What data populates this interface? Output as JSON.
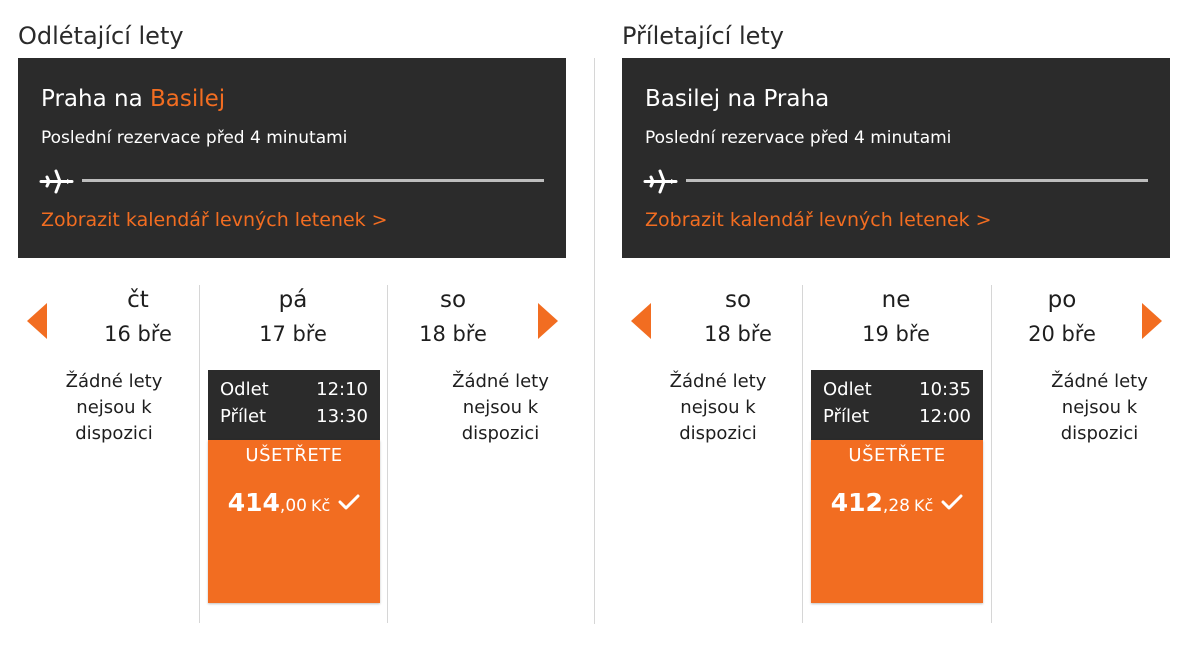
{
  "outbound": {
    "section_title": "Odlétající lety",
    "route_from": "Praha na",
    "route_to": "Basilej",
    "last_booking": "Poslední rezervace před 4 minutami",
    "calendar_link": "Zobrazit kalendář levných letenek >",
    "days": [
      {
        "day": "čt",
        "date": "16 bře",
        "no_flights": [
          "Žádné lety",
          "nejsou k",
          "dispozici"
        ]
      },
      {
        "day": "pá",
        "date": "17 bře",
        "flight": {
          "depart_label": "Odlet",
          "depart": "12:10",
          "arrive_label": "Přílet",
          "arrive": "13:30",
          "save": "UŠETŘETE",
          "price_main": "414",
          "price_dec": ",00",
          "currency": "Kč"
        }
      },
      {
        "day": "so",
        "date": "18 bře",
        "no_flights": [
          "Žádné lety",
          "nejsou k",
          "dispozici"
        ]
      }
    ]
  },
  "inbound": {
    "section_title": "Příletající lety",
    "route_from": "Basilej na Praha",
    "last_booking": "Poslední rezervace před 4 minutami",
    "calendar_link": "Zobrazit kalendář levných letenek >",
    "days": [
      {
        "day": "so",
        "date": "18 bře",
        "no_flights": [
          "Žádné lety",
          "nejsou k",
          "dispozici"
        ]
      },
      {
        "day": "ne",
        "date": "19 bře",
        "flight": {
          "depart_label": "Odlet",
          "depart": "10:35",
          "arrive_label": "Přílet",
          "arrive": "12:00",
          "save": "UŠETŘETE",
          "price_main": "412",
          "price_dec": ",28",
          "currency": "Kč"
        }
      },
      {
        "day": "po",
        "date": "20 bře",
        "no_flights": [
          "Žádné lety",
          "nejsou k",
          "dispozici"
        ]
      }
    ]
  },
  "icons": {
    "plane": "plane-icon",
    "prev": "arrow-left-icon",
    "next": "arrow-right-icon",
    "check": "check-icon"
  },
  "colors": {
    "accent": "#f26d21",
    "dark": "#2b2b2b",
    "divider": "#d6d6d6"
  }
}
